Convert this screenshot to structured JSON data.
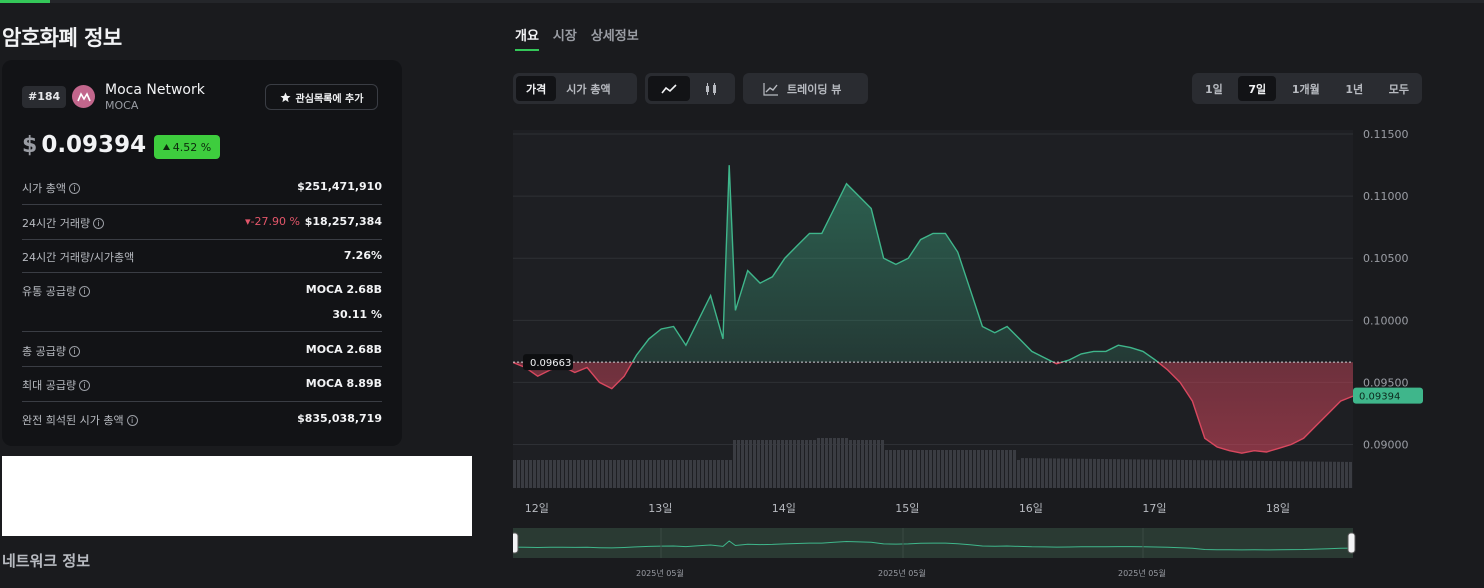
{
  "page": {
    "title": "암호화폐 정보"
  },
  "coin": {
    "rank": "#184",
    "name": "Moca Network",
    "symbol": "MOCA",
    "watch_label": "관심목록에 추가",
    "currency": "$",
    "price": "0.09394",
    "change": "4.52 %"
  },
  "stats": {
    "market_cap": {
      "label": "시가 총액",
      "value": "$251,471,910"
    },
    "volume_24h": {
      "label": "24시간 거래량",
      "change": "-27.90 %",
      "value": "$18,257,384"
    },
    "vol_mcap": {
      "label": "24시간 거래량/시가총액",
      "value": "7.26%"
    },
    "circulating": {
      "label": "유통 공급량",
      "value": "MOCA 2.68B",
      "percent": "30.11 %"
    },
    "total": {
      "label": "총 공급량",
      "value": "MOCA 2.68B"
    },
    "max": {
      "label": "최대 공급량",
      "value": "MOCA 8.89B"
    },
    "fdv": {
      "label": "완전 희석된 시가 총액",
      "value": "$835,038,719"
    }
  },
  "network_title": "네트워크 정보",
  "tabs": [
    "개요",
    "시장",
    "상세정보"
  ],
  "chart_toggle": {
    "price": "가격",
    "market_cap": "시가 총액"
  },
  "trading_view": "트레이딩 뷰",
  "ranges": [
    "1일",
    "7일",
    "1개월",
    "1년",
    "모두"
  ],
  "active_range": "7일",
  "icons": {
    "star": "star-icon",
    "line": "line-chart-icon",
    "candle": "candlestick-icon",
    "tv": "trading-view-icon",
    "info": "info-icon"
  },
  "colors": {
    "up": "#3fb68b",
    "down": "#d9485f",
    "badge": "#3ecd3e",
    "accent": "#34c759"
  },
  "chart_data": {
    "type": "area",
    "reference_price": "0.09663",
    "current_price": "0.09394",
    "x_ticks": [
      "12일",
      "13일",
      "14일",
      "15일",
      "16일",
      "17일",
      "18일"
    ],
    "y_ticks": [
      "0.11500",
      "0.11000",
      "0.10500",
      "0.10000",
      "0.09500",
      "0.09000"
    ],
    "ylim": [
      0.0865,
      0.115
    ],
    "points": [
      [
        11.8,
        0.0966
      ],
      [
        11.9,
        0.0962
      ],
      [
        12.0,
        0.0955
      ],
      [
        12.1,
        0.096
      ],
      [
        12.2,
        0.0963
      ],
      [
        12.3,
        0.0958
      ],
      [
        12.4,
        0.0962
      ],
      [
        12.5,
        0.095
      ],
      [
        12.6,
        0.0945
      ],
      [
        12.7,
        0.0955
      ],
      [
        12.8,
        0.0972
      ],
      [
        12.9,
        0.0985
      ],
      [
        13.0,
        0.0993
      ],
      [
        13.1,
        0.0995
      ],
      [
        13.2,
        0.098
      ],
      [
        13.3,
        0.1
      ],
      [
        13.4,
        0.102
      ],
      [
        13.5,
        0.0985
      ],
      [
        13.55,
        0.1125
      ],
      [
        13.6,
        0.1008
      ],
      [
        13.7,
        0.104
      ],
      [
        13.8,
        0.103
      ],
      [
        13.9,
        0.1035
      ],
      [
        14.0,
        0.105
      ],
      [
        14.1,
        0.106
      ],
      [
        14.2,
        0.107
      ],
      [
        14.3,
        0.107
      ],
      [
        14.4,
        0.109
      ],
      [
        14.5,
        0.111
      ],
      [
        14.6,
        0.11
      ],
      [
        14.7,
        0.109
      ],
      [
        14.8,
        0.105
      ],
      [
        14.9,
        0.1045
      ],
      [
        15.0,
        0.105
      ],
      [
        15.1,
        0.1065
      ],
      [
        15.2,
        0.107
      ],
      [
        15.3,
        0.107
      ],
      [
        15.4,
        0.1055
      ],
      [
        15.5,
        0.1025
      ],
      [
        15.6,
        0.0995
      ],
      [
        15.7,
        0.099
      ],
      [
        15.8,
        0.0995
      ],
      [
        15.9,
        0.0985
      ],
      [
        16.0,
        0.0975
      ],
      [
        16.1,
        0.097
      ],
      [
        16.2,
        0.0965
      ],
      [
        16.3,
        0.0968
      ],
      [
        16.4,
        0.0973
      ],
      [
        16.5,
        0.0975
      ],
      [
        16.6,
        0.0975
      ],
      [
        16.7,
        0.098
      ],
      [
        16.8,
        0.0978
      ],
      [
        16.9,
        0.0975
      ],
      [
        17.0,
        0.0968
      ],
      [
        17.1,
        0.096
      ],
      [
        17.2,
        0.095
      ],
      [
        17.3,
        0.0935
      ],
      [
        17.4,
        0.0905
      ],
      [
        17.5,
        0.0898
      ],
      [
        17.6,
        0.0895
      ],
      [
        17.7,
        0.0893
      ],
      [
        17.8,
        0.0895
      ],
      [
        17.9,
        0.0894
      ],
      [
        18.0,
        0.0897
      ],
      [
        18.1,
        0.09
      ],
      [
        18.2,
        0.0905
      ],
      [
        18.3,
        0.0915
      ],
      [
        18.4,
        0.0925
      ],
      [
        18.5,
        0.0935
      ],
      [
        18.6,
        0.0939
      ]
    ],
    "navigator_labels": [
      "2025년 05월",
      "2025년 05월",
      "2025년 05월"
    ]
  }
}
